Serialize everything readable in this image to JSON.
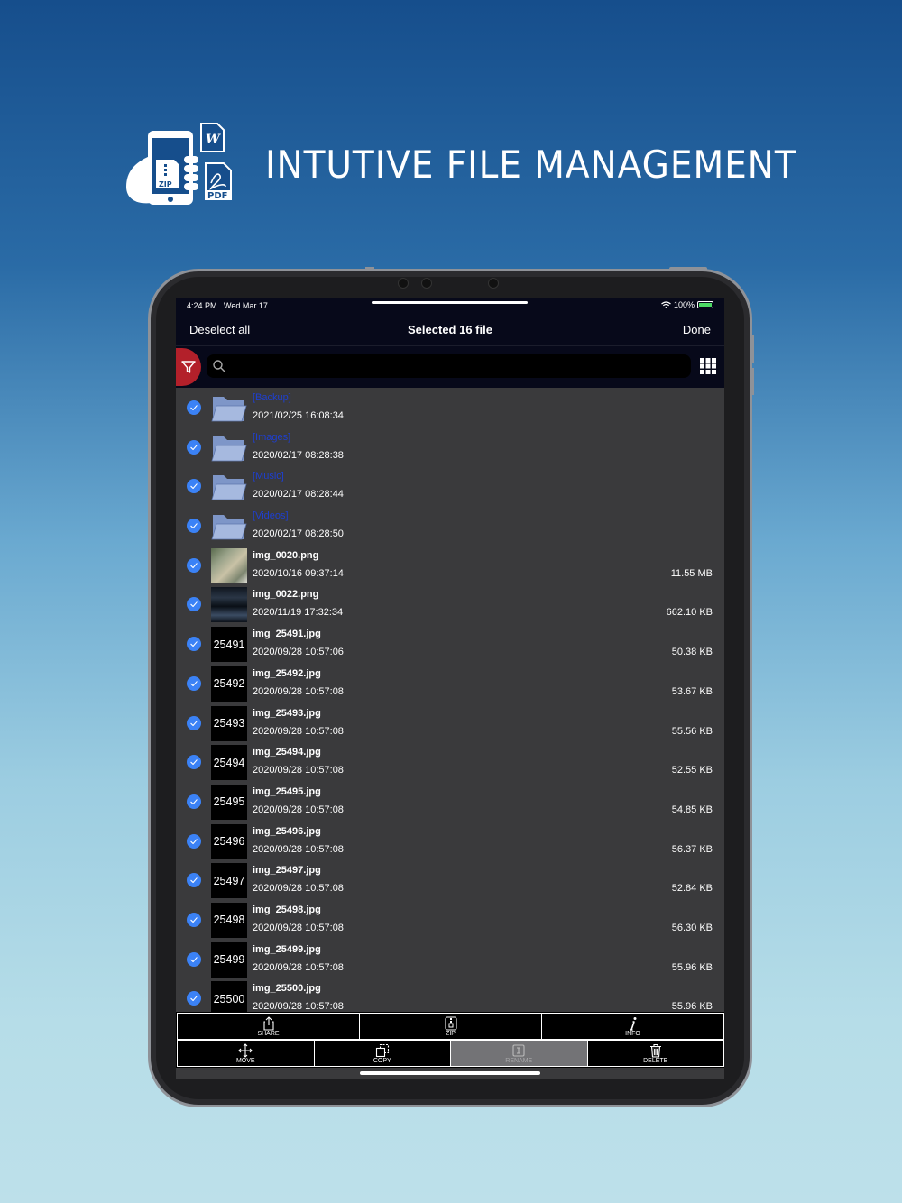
{
  "hero": {
    "title": "INTUTIVE FILE MANAGEMENT",
    "logo_icons": [
      "phone-hand-icon",
      "zip-file-icon",
      "word-file-icon",
      "pdf-file-icon"
    ],
    "logo_labels": {
      "zip": "ZIP",
      "word": "W",
      "pdf": "PDF"
    }
  },
  "status": {
    "time": "4:24 PM",
    "date": "Wed Mar 17",
    "battery": "100%"
  },
  "nav": {
    "left": "Deselect all",
    "title": "Selected 16 file",
    "right": "Done"
  },
  "search": {
    "placeholder": ""
  },
  "files": [
    {
      "kind": "folder",
      "name": "[Backup]",
      "date": "2021/02/25 16:08:34",
      "size": ""
    },
    {
      "kind": "folder",
      "name": "[Images]",
      "date": "2020/02/17 08:28:38",
      "size": ""
    },
    {
      "kind": "folder",
      "name": "[Music]",
      "date": "2020/02/17 08:28:44",
      "size": ""
    },
    {
      "kind": "folder",
      "name": "[Videos]",
      "date": "2020/02/17 08:28:50",
      "size": ""
    },
    {
      "kind": "photo1",
      "name": "img_0020.png",
      "date": "2020/10/16 09:37:14",
      "size": "11.55 MB"
    },
    {
      "kind": "photo2",
      "name": "img_0022.png",
      "date": "2020/11/19 17:32:34",
      "size": "662.10 KB"
    },
    {
      "kind": "num",
      "thumb": "25491",
      "name": "img_25491.jpg",
      "date": "2020/09/28 10:57:06",
      "size": "50.38 KB"
    },
    {
      "kind": "num",
      "thumb": "25492",
      "name": "img_25492.jpg",
      "date": "2020/09/28 10:57:08",
      "size": "53.67 KB"
    },
    {
      "kind": "num",
      "thumb": "25493",
      "name": "img_25493.jpg",
      "date": "2020/09/28 10:57:08",
      "size": "55.56 KB"
    },
    {
      "kind": "num",
      "thumb": "25494",
      "name": "img_25494.jpg",
      "date": "2020/09/28 10:57:08",
      "size": "52.55 KB"
    },
    {
      "kind": "num",
      "thumb": "25495",
      "name": "img_25495.jpg",
      "date": "2020/09/28 10:57:08",
      "size": "54.85 KB"
    },
    {
      "kind": "num",
      "thumb": "25496",
      "name": "img_25496.jpg",
      "date": "2020/09/28 10:57:08",
      "size": "56.37 KB"
    },
    {
      "kind": "num",
      "thumb": "25497",
      "name": "img_25497.jpg",
      "date": "2020/09/28 10:57:08",
      "size": "52.84 KB"
    },
    {
      "kind": "num",
      "thumb": "25498",
      "name": "img_25498.jpg",
      "date": "2020/09/28 10:57:08",
      "size": "56.30 KB"
    },
    {
      "kind": "num",
      "thumb": "25499",
      "name": "img_25499.jpg",
      "date": "2020/09/28 10:57:08",
      "size": "55.96 KB"
    },
    {
      "kind": "num",
      "thumb": "25500",
      "name": "img_25500.jpg",
      "date": "2020/09/28 10:57:08",
      "size": "55.96 KB"
    }
  ],
  "toolbar": {
    "share": "SHARE",
    "zip": "ZIP",
    "info": "INFO",
    "move": "MOVE",
    "copy": "COPY",
    "rename": "RENAME",
    "delete": "DELETE"
  },
  "colors": {
    "accent": "#3b82f6",
    "filter": "#b3202a",
    "folder_text": "#1e3fd0",
    "nav_bg": "#07091a",
    "list_bg": "#3a3a3c"
  }
}
